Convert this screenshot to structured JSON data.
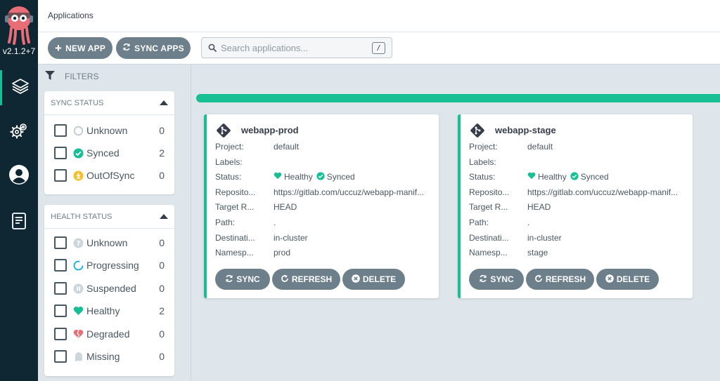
{
  "nav": {
    "version": "v2.1.2+7",
    "items": [
      "applications-icon",
      "settings-icon",
      "user-icon",
      "docs-icon"
    ]
  },
  "header": {
    "title": "Applications"
  },
  "toolbar": {
    "new_app_label": "NEW APP",
    "sync_apps_label": "SYNC APPS",
    "search_placeholder": "Search applications...",
    "search_shortcut": "/"
  },
  "filters": {
    "title": "FILTERS",
    "sync_status": {
      "title": "SYNC STATUS",
      "items": [
        {
          "label": "Unknown",
          "count": "0",
          "icon": "unknown-icon"
        },
        {
          "label": "Synced",
          "count": "2",
          "icon": "check-circle-icon"
        },
        {
          "label": "OutOfSync",
          "count": "0",
          "icon": "out-of-sync-icon"
        }
      ]
    },
    "health_status": {
      "title": "HEALTH STATUS",
      "items": [
        {
          "label": "Unknown",
          "count": "0",
          "icon": "question-icon"
        },
        {
          "label": "Progressing",
          "count": "0",
          "icon": "progress-ring-icon"
        },
        {
          "label": "Suspended",
          "count": "0",
          "icon": "pause-icon"
        },
        {
          "label": "Healthy",
          "count": "2",
          "icon": "heart-icon"
        },
        {
          "label": "Degraded",
          "count": "0",
          "icon": "broken-heart-icon"
        },
        {
          "label": "Missing",
          "count": "0",
          "icon": "ghost-icon"
        }
      ]
    }
  },
  "colors": {
    "accent": "#18be94",
    "sidebar": "#0f2733",
    "button": "#6d7f8b",
    "warning": "#f4c030",
    "degraded": "#e96d76"
  },
  "apps": [
    {
      "name": "webapp-prod",
      "fields": [
        {
          "key": "Project:",
          "value": "default"
        },
        {
          "key": "Labels:",
          "value": ""
        },
        {
          "key": "Status:",
          "health": "Healthy",
          "sync": "Synced"
        },
        {
          "key": "Reposito...",
          "value": "https://gitlab.com/uccuz/webapp-manif..."
        },
        {
          "key": "Target R...",
          "value": "HEAD"
        },
        {
          "key": "Path:",
          "value": "."
        },
        {
          "key": "Destinati...",
          "value": "in-cluster"
        },
        {
          "key": "Namesp...",
          "value": "prod"
        }
      ],
      "buttons": {
        "sync": "SYNC",
        "refresh": "REFRESH",
        "delete": "DELETE"
      }
    },
    {
      "name": "webapp-stage",
      "fields": [
        {
          "key": "Project:",
          "value": "default"
        },
        {
          "key": "Labels:",
          "value": ""
        },
        {
          "key": "Status:",
          "health": "Healthy",
          "sync": "Synced"
        },
        {
          "key": "Reposito...",
          "value": "https://gitlab.com/uccuz/webapp-manif..."
        },
        {
          "key": "Target R...",
          "value": "HEAD"
        },
        {
          "key": "Path:",
          "value": "."
        },
        {
          "key": "Destinati...",
          "value": "in-cluster"
        },
        {
          "key": "Namesp...",
          "value": "stage"
        }
      ],
      "buttons": {
        "sync": "SYNC",
        "refresh": "REFRESH",
        "delete": "DELETE"
      }
    }
  ]
}
